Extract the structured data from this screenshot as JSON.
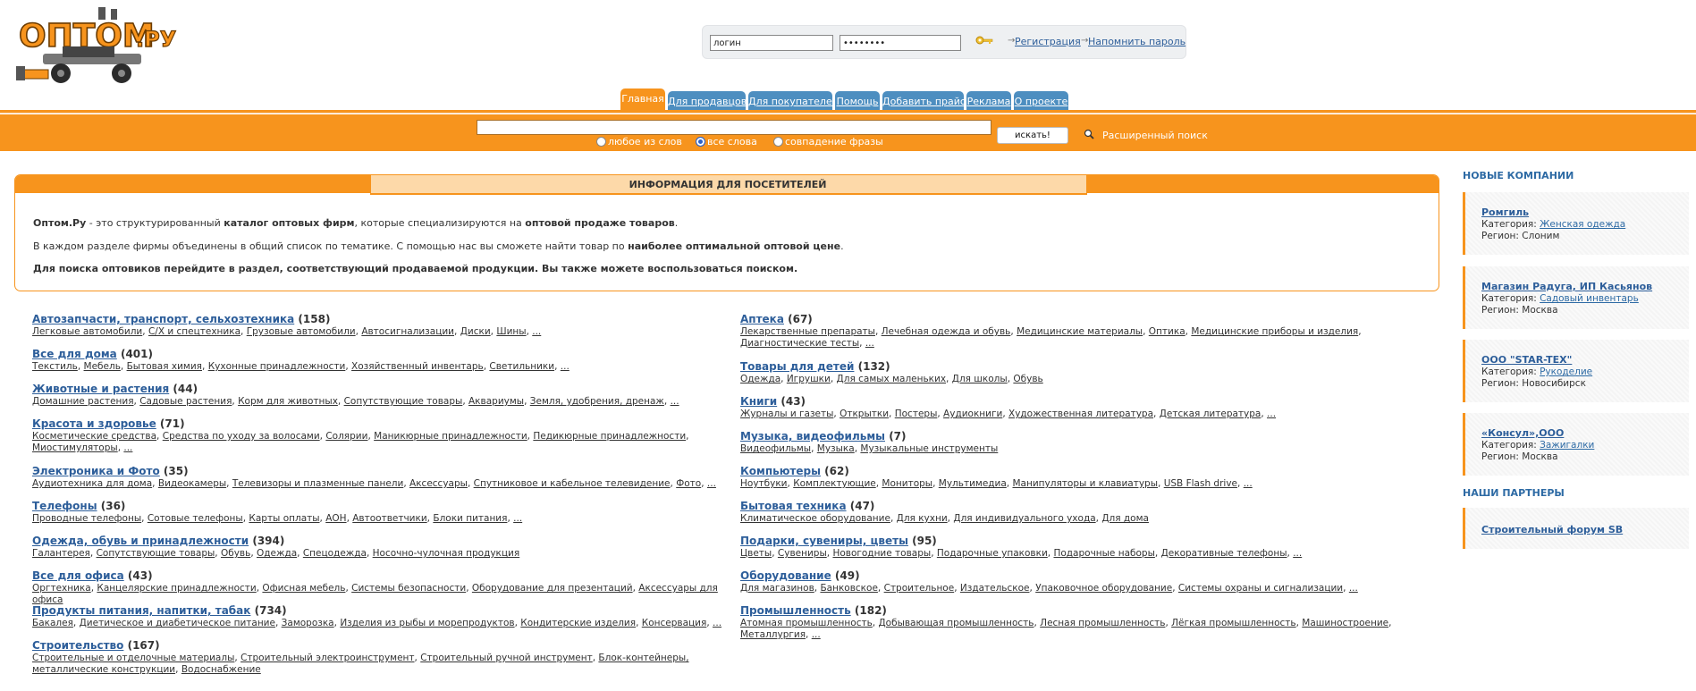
{
  "logo": {
    "text": "ОПТОМ.РУ"
  },
  "login": {
    "login_value": "логин",
    "password_value": "••••••••",
    "register_link": "Регистрация",
    "remind_link": "Напомнить пароль"
  },
  "tabs": [
    {
      "label": "Главная",
      "active": true
    },
    {
      "label": "Для продавцов"
    },
    {
      "label": "Для покупателей"
    },
    {
      "label": "Помощь"
    },
    {
      "label": "Добавить прайс"
    },
    {
      "label": "Реклама"
    },
    {
      "label": "О проекте"
    }
  ],
  "search": {
    "query": "",
    "radio_any": "любое из слов",
    "radio_all": "все слова",
    "radio_phrase": "совпадение фразы",
    "selected": "все слова",
    "button": "искать!",
    "advanced": "Расширенный поиск"
  },
  "info": {
    "title": "ИНФОРМАЦИЯ ДЛЯ ПОСЕТИТЕЛЕЙ",
    "p1_a": "Оптом.Ру",
    "p1_b": " - это структурированный ",
    "p1_c": "каталог оптовых фирм",
    "p1_d": ", которые специализируются на ",
    "p1_e": "оптовой продаже товаров",
    "p1_f": ".",
    "p2_a": "В каждом разделе фирмы объединены в общий список по тематике. С помощью нас вы сможете найти товар по ",
    "p2_b": "наиболее оптимальной оптовой цене",
    "p2_c": ".",
    "p3": "Для поиска оптовиков перейдите в раздел, соответствующий продаваемой продукции. Вы также можете воспользоваться поиском."
  },
  "categories_left": [
    {
      "name": "Автозапчасти, транспорт, сельхозтехника",
      "count": "(158)",
      "subs": [
        "Легковые автомобили",
        "С/Х и спецтехника",
        "Грузовые автомобили",
        "Автосигнализации",
        "Диски",
        "Шины",
        "..."
      ]
    },
    {
      "name": "Все для дома",
      "count": "(401)",
      "subs": [
        "Текстиль",
        "Мебель",
        "Бытовая химия",
        "Кухонные принадлежности",
        "Хозяйственный инвентарь",
        "Светильники",
        "..."
      ]
    },
    {
      "name": "Животные и растения",
      "count": "(44)",
      "subs": [
        "Домашние растения",
        "Садовые растения",
        "Корм для животных",
        "Сопутствующие товары",
        "Аквариумы",
        "Земля, удобрения, дренаж",
        "..."
      ]
    },
    {
      "name": "Красота и здоровье",
      "count": "(71)",
      "subs": [
        "Косметические средства",
        "Средства по уходу за волосами",
        "Солярии",
        "Маникюрные принадлежности",
        "Педикюрные принадлежности",
        "Миостимуляторы",
        "..."
      ]
    },
    {
      "name": "Электроника и Фото",
      "count": "(35)",
      "subs": [
        "Аудиотехника для дома",
        "Видеокамеры",
        "Телевизоры и плазменные панели",
        "Аксессуары",
        "Спутниковое и кабельное телевидение",
        "Фото",
        "..."
      ]
    },
    {
      "name": "Телефоны",
      "count": "(36)",
      "subs": [
        "Проводные телефоны",
        "Сотовые телефоны",
        "Карты оплаты",
        "АОН",
        "Автоответчики",
        "Блоки питания",
        "..."
      ]
    },
    {
      "name": "Одежда, обувь и принадлежности",
      "count": "(394)",
      "subs": [
        "Галантерея",
        "Сопутствующие товары",
        "Обувь",
        "Одежда",
        "Спецодежда",
        "Носочно-чулочная продукция"
      ]
    },
    {
      "name": "Все для офиса",
      "count": "(43)",
      "subs": [
        "Оргтехника",
        "Канцелярские принадлежности",
        "Офисная мебель",
        "Системы безопасности",
        "Оборудование для презентаций",
        "Аксессуары для офиса"
      ]
    },
    {
      "name": "Продукты питания, напитки, табак",
      "count": "(734)",
      "subs": [
        "Бакалея",
        "Диетическое и диабетическое питание",
        "Заморозка",
        "Изделия из рыбы и морепродуктов",
        "Кондитерские изделия",
        "Консервация",
        "..."
      ]
    },
    {
      "name": "Строительство",
      "count": "(167)",
      "subs": [
        "Строительные и отделочные материалы",
        "Строительный электроинструмент",
        "Строительный ручной инструмент",
        "Блок-контейнеры, металлические конструкции",
        "Водоснабжение"
      ]
    }
  ],
  "categories_right": [
    {
      "name": "Аптека",
      "count": "(67)",
      "subs": [
        "Лекарственные препараты",
        "Лечебная одежда и обувь",
        "Медицинские материалы",
        "Оптика",
        "Медицинские приборы и изделия",
        "Диагностические тесты",
        "..."
      ]
    },
    {
      "name": "Товары для детей",
      "count": "(132)",
      "subs": [
        "Одежда",
        "Игрушки",
        "Для самых маленьких",
        "Для школы",
        "Обувь"
      ]
    },
    {
      "name": "Книги",
      "count": "(43)",
      "subs": [
        "Журналы и газеты",
        "Открытки",
        "Постеры",
        "Аудиокниги",
        "Художественная литература",
        "Детская литература",
        "..."
      ]
    },
    {
      "name": "Музыка, видеофильмы",
      "count": "(7)",
      "subs": [
        "Видеофильмы",
        "Музыка",
        "Музыкальные инструменты"
      ]
    },
    {
      "name": "Компьютеры",
      "count": "(62)",
      "subs": [
        "Ноутбуки",
        "Комплектующие",
        "Мониторы",
        "Мультимедиа",
        "Манипуляторы и клавиатуры",
        "USB Flash drive",
        "..."
      ]
    },
    {
      "name": "Бытовая техника",
      "count": "(47)",
      "subs": [
        "Климатическое оборудование",
        "Для кухни",
        "Для индивидуального ухода",
        "Для дома"
      ]
    },
    {
      "name": "Подарки, сувениры, цветы",
      "count": "(95)",
      "subs": [
        "Цветы",
        "Сувениры",
        "Новогодние товары",
        "Подарочные упаковки",
        "Подарочные наборы",
        "Декоративные телефоны",
        "..."
      ]
    },
    {
      "name": "Оборудование",
      "count": "(49)",
      "subs": [
        "Для магазинов",
        "Банковское",
        "Строительное",
        "Издательское",
        "Упаковочное оборудование",
        "Системы охраны и сигнализации",
        "..."
      ]
    },
    {
      "name": "Промышленность",
      "count": "(182)",
      "subs": [
        "Атомная промышленность",
        "Добывающая промышленность",
        "Лесная промышленность",
        "Лёгкая промышленность",
        "Машиностроение",
        "Металлургия",
        "..."
      ]
    }
  ],
  "sidebar": {
    "new_title": "НОВЫЕ КОМПАНИИ",
    "category_label": "Категория: ",
    "region_label": "Регион: ",
    "companies": [
      {
        "name": "Ромгиль",
        "category": "Женская одежда",
        "region": "Слоним"
      },
      {
        "name": "Магазин Радуга, ИП Касьянов",
        "category": "Садовый инвентарь",
        "region": "Москва"
      },
      {
        "name": "ООО \"STAR-TEX\"",
        "category": "Рукоделие",
        "region": "Новосибирск"
      },
      {
        "name": "«Консул»,ООО",
        "category": "Зажигалки",
        "region": "Москва"
      }
    ],
    "partners_title": "НАШИ ПАРТНЕРЫ",
    "partners": [
      {
        "name": "Строительный форум SB"
      }
    ]
  }
}
